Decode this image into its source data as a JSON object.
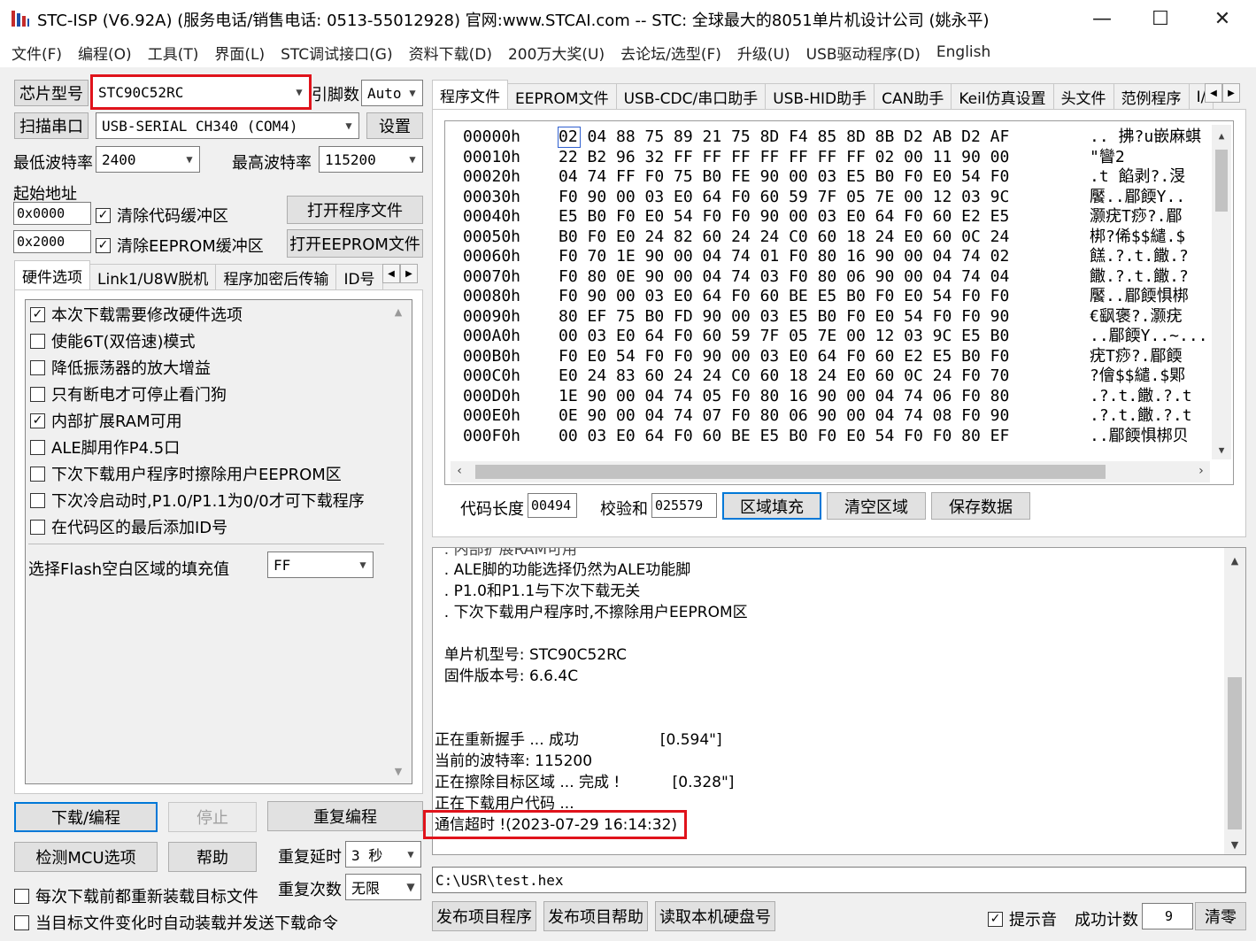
{
  "window": {
    "title": "STC-ISP (V6.92A) (服务电话/销售电话: 0513-55012928) 官网:www.STCAI.com  -- STC: 全球最大的8051单片机设计公司 (姚永平)",
    "minimize": "—",
    "maximize": "☐",
    "close": "✕"
  },
  "menu": [
    "文件(F)",
    "编程(O)",
    "工具(T)",
    "界面(L)",
    "STC调试接口(G)",
    "资料下载(D)",
    "200万大奖(U)",
    "去论坛/选型(F)",
    "升级(U)",
    "USB驱动程序(D)",
    "English"
  ],
  "left": {
    "chip_label": "芯片型号",
    "chip_value": "STC90C52RC",
    "pins_label": "引脚数",
    "pins_value": "Auto",
    "scan_port_btn": "扫描串口",
    "port_value": "USB-SERIAL CH340 (COM4)",
    "settings_btn": "设置",
    "min_baud_label": "最低波特率",
    "min_baud_value": "2400",
    "max_baud_label": "最高波特率",
    "max_baud_value": "115200",
    "start_addr_label": "起始地址",
    "addr1": "0x0000",
    "clear_code_buffer": "清除代码缓冲区",
    "open_program_btn": "打开程序文件",
    "addr2": "0x2000",
    "clear_eeprom_buffer": "清除EEPROM缓冲区",
    "open_eeprom_btn": "打开EEPROM文件",
    "tabs": [
      "硬件选项",
      "Link1/U8W脱机",
      "程序加密后传输",
      "ID号"
    ],
    "options": [
      {
        "label": "本次下载需要修改硬件选项",
        "checked": true
      },
      {
        "label": "使能6T(双倍速)模式",
        "checked": false
      },
      {
        "label": "降低振荡器的放大增益",
        "checked": false
      },
      {
        "label": "只有断电才可停止看门狗",
        "checked": false
      },
      {
        "label": "内部扩展RAM可用",
        "checked": true
      },
      {
        "label": "ALE脚用作P4.5口",
        "checked": false
      },
      {
        "label": "下次下载用户程序时擦除用户EEPROM区",
        "checked": false
      },
      {
        "label": "下次冷启动时,P1.0/P1.1为0/0才可下载程序",
        "checked": false
      },
      {
        "label": "在代码区的最后添加ID号",
        "checked": false
      }
    ],
    "fill_label": "选择Flash空白区域的填充值",
    "fill_value": "FF",
    "download_btn": "下载/编程",
    "stop_btn": "停止",
    "reprogram_btn": "重复编程",
    "detect_btn": "检测MCU选项",
    "help_btn": "帮助",
    "repeat_delay_label": "重复延时",
    "repeat_delay_value": "3 秒",
    "repeat_count_label": "重复次数",
    "repeat_count_value": "无限",
    "reload_before_download": "每次下载前都重新装载目标文件",
    "auto_load_on_change": "当目标文件变化时自动装载并发送下载命令"
  },
  "right": {
    "tabs": [
      "程序文件",
      "EEPROM文件",
      "USB-CDC/串口助手",
      "USB-HID助手",
      "CAN助手",
      "Keil仿真设置",
      "头文件",
      "范例程序",
      "I/"
    ],
    "hex_rows": [
      {
        "addr": "00000h",
        "bytes": "02 04 88 75 89 21 75 8D F4 85 8D 8B D2 AB D2 AF",
        "ascii": ".. 拂?u嵌麻蜞"
      },
      {
        "addr": "00010h",
        "bytes": "22 B2 96 32 FF FF FF FF FF FF FF 02 00 11 90 00",
        "ascii": "\"矕2"
      },
      {
        "addr": "00020h",
        "bytes": "04 74 FF F0 75 B0 FE 90 00 03 E5 B0 F0 E0 54 F0",
        "ascii": ".t  餡剥?.渂"
      },
      {
        "addr": "00030h",
        "bytes": "F0 90 00 03 E0 64 F0 60 59 7F 05 7E 00 12 03 9C",
        "ascii": "饜..郿餪Y.."
      },
      {
        "addr": "00040h",
        "bytes": "E5 B0 F0 E0 54 F0 F0 90 00 03 E0 64 F0 60 E2 E5",
        "ascii": "灏疣T痧?.郿"
      },
      {
        "addr": "00050h",
        "bytes": "B0 F0 E0 24 82 60 24 24 C0 60 18 24 E0 60 0C 24",
        "ascii": "梆?俙$$繾.$"
      },
      {
        "addr": "00060h",
        "bytes": "F0 70 1E 90 00 04 74 01 F0 80 16 90 00 04 74 02",
        "ascii": "餻.?.t.饊.?"
      },
      {
        "addr": "00070h",
        "bytes": "F0 80 0E 90 00 04 74 03 F0 80 06 90 00 04 74 04",
        "ascii": "饊.?.t.饊.?"
      },
      {
        "addr": "00080h",
        "bytes": "F0 90 00 03 E0 64 F0 60 BE E5 B0 F0 E0 54 F0 F0",
        "ascii": "饜..郿餪惧梆"
      },
      {
        "addr": "00090h",
        "bytes": "80 EF 75 B0 FD 90 00 03 E5 B0 F0 E0 54 F0 F0 90",
        "ascii": "€飖褒?.灏疣"
      },
      {
        "addr": "000A0h",
        "bytes": "00 03 E0 64 F0 60 59 7F 05 7E 00 12 03 9C E5 B0",
        "ascii": "..郿餪Y..~..."
      },
      {
        "addr": "000B0h",
        "bytes": "F0 E0 54 F0 F0 90 00 03 E0 64 F0 60 E2 E5 B0 F0",
        "ascii": "疣T痧?.郿餪"
      },
      {
        "addr": "000C0h",
        "bytes": "E0 24 83 60 24 24 C0 60 18 24 E0 60 0C 24 F0 70",
        "ascii": "?儈$$繾.$郹"
      },
      {
        "addr": "000D0h",
        "bytes": "1E 90 00 04 74 05 F0 80 16 90 00 04 74 06 F0 80",
        "ascii": ".?.t.饊.?.t"
      },
      {
        "addr": "000E0h",
        "bytes": "0E 90 00 04 74 07 F0 80 06 90 00 04 74 08 F0 90",
        "ascii": ".?.t.饊.?.t"
      },
      {
        "addr": "000F0h",
        "bytes": "00 03 E0 64 F0 60 BE E5 B0 F0 E0 54 F0 F0 80 EF",
        "ascii": "..郿餪惧梆贝"
      }
    ],
    "code_len_label": "代码长度",
    "code_len_value": "00494",
    "checksum_label": "校验和",
    "checksum_value": "025579",
    "fill_region_btn": "区域填充",
    "clear_region_btn": "清空区域",
    "save_data_btn": "保存数据",
    "log_lines": [
      "  . 内部扩展RAM可用",
      "  . ALE脚的功能选择仍然为ALE功能脚",
      "  . P1.0和P1.1与下次下载无关",
      "  . 下次下载用户程序时,不擦除用户EEPROM区",
      "",
      "  单片机型号: STC90C52RC",
      "  固件版本号: 6.6.4C",
      "",
      "",
      "正在重新握手 ... 成功                 [0.594\"]",
      "当前的波特率: 115200",
      "正在擦除目标区域 ... 完成 !           [0.328\"]",
      "正在下载用户代码 ...",
      "通信超时 !(2023-07-29 16:14:32)"
    ],
    "file_path": "C:\\USR\\test.hex",
    "publish_program_btn": "发布项目程序",
    "publish_help_btn": "发布项目帮助",
    "read_disk_btn": "读取本机硬盘号",
    "sound_label": "提示音",
    "success_count_label": "成功计数",
    "success_count_value": "9",
    "clear_btn": "清零"
  }
}
